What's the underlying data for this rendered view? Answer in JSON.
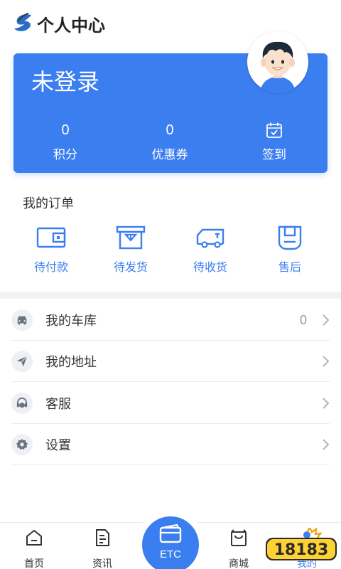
{
  "header": {
    "title": "个人中心"
  },
  "profile": {
    "status": "未登录",
    "stats": [
      {
        "value": "0",
        "label": "积分"
      },
      {
        "value": "0",
        "label": "优惠券"
      },
      {
        "label": "签到",
        "icon": "calendar-check-icon"
      }
    ]
  },
  "orders": {
    "title": "我的订单",
    "items": [
      {
        "label": "待付款",
        "icon": "wallet-icon"
      },
      {
        "label": "待发货",
        "icon": "box-icon"
      },
      {
        "label": "待收货",
        "icon": "truck-icon"
      },
      {
        "label": "售后",
        "icon": "return-bag-icon"
      }
    ]
  },
  "menu": [
    {
      "label": "我的车库",
      "count": "0",
      "icon": "car-icon"
    },
    {
      "label": "我的地址",
      "count": "",
      "icon": "send-icon"
    },
    {
      "label": "客服",
      "count": "",
      "icon": "headset-icon"
    },
    {
      "label": "设置",
      "count": "",
      "icon": "gear-icon"
    }
  ],
  "bottom_nav": {
    "items": [
      {
        "label": "首页",
        "icon": "home-icon"
      },
      {
        "label": "资讯",
        "icon": "document-icon"
      },
      {
        "label": "ETC",
        "icon": "etc-card-icon"
      },
      {
        "label": "商城",
        "icon": "shopping-bag-icon"
      },
      {
        "label": "我的",
        "icon": "user-icon"
      }
    ],
    "active": "我的"
  },
  "watermark": {
    "text": "18183"
  },
  "colors": {
    "primary": "#3b7ef0",
    "text": "#333333",
    "muted": "#999999",
    "band": "#f2f3f5"
  }
}
